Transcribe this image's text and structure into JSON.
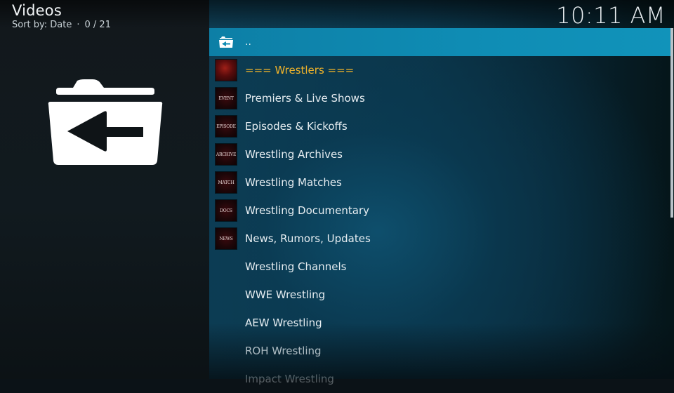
{
  "header": {
    "title": "Videos",
    "sort_label": "Sort by: Date",
    "separator": "·",
    "position": "0 / 21",
    "clock": "10:11 AM"
  },
  "side_panel": {
    "icon": "folder-back-icon"
  },
  "list": {
    "items": [
      {
        "label": "..",
        "icon": "folder-back-icon",
        "thumb_text": "",
        "focused": true
      },
      {
        "label": "=== Wrestlers ===",
        "icon": "thumbnail",
        "thumb_text": "",
        "highlight_color": "#f0b32a"
      },
      {
        "label": "Premiers & Live Shows",
        "icon": "thumbnail",
        "thumb_text": "EVENT"
      },
      {
        "label": "Episodes & Kickoffs",
        "icon": "thumbnail",
        "thumb_text": "EPISODE"
      },
      {
        "label": "Wrestling Archives",
        "icon": "thumbnail",
        "thumb_text": "ARCHIVE"
      },
      {
        "label": "Wrestling Matches",
        "icon": "thumbnail",
        "thumb_text": "MATCH"
      },
      {
        "label": "Wrestling Documentary",
        "icon": "thumbnail",
        "thumb_text": "DOCS"
      },
      {
        "label": "News, Rumors, Updates",
        "icon": "thumbnail",
        "thumb_text": "NEWS"
      },
      {
        "label": "Wrestling Channels"
      },
      {
        "label": "WWE Wrestling"
      },
      {
        "label": "AEW Wrestling"
      },
      {
        "label": "ROH Wrestling"
      },
      {
        "label": "Impact Wrestling"
      }
    ]
  },
  "scrollbar": {
    "visible_fraction": 0.54,
    "position_fraction": 0.0
  },
  "colors": {
    "focus": "#0f8db5",
    "accent_gold": "#f0b32a"
  }
}
